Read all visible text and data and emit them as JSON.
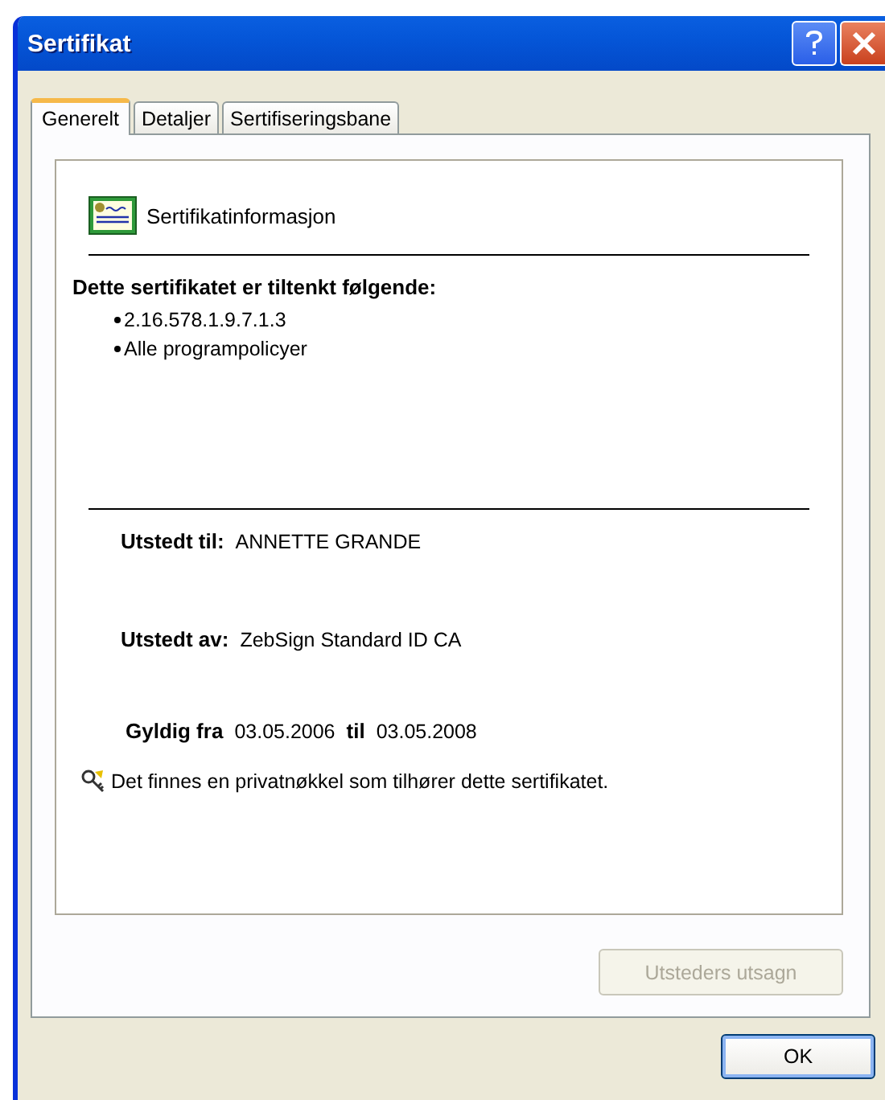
{
  "window": {
    "title": "Sertifikat"
  },
  "tabs": [
    {
      "label": "Generelt",
      "selected": true
    },
    {
      "label": "Detaljer",
      "selected": false
    },
    {
      "label": "Sertifiseringsbane",
      "selected": false
    }
  ],
  "certificate_info": {
    "title": "Sertifikatinformasjon",
    "purpose_heading": "Dette sertifikatet er tiltenkt følgende:",
    "purposes": [
      "2.16.578.1.9.7.1.3",
      "Alle programpolicyer"
    ],
    "issued_to": {
      "label": "Utstedt til:",
      "value": "ANNETTE GRANDE"
    },
    "issued_by": {
      "label": "Utstedt av:",
      "value": "ZebSign Standard ID CA"
    },
    "validity": {
      "from_label": "Gyldig fra",
      "from": "03.05.2006",
      "to_label": "til",
      "to": "03.05.2008"
    },
    "private_key_note": "Det finnes en privatnøkkel som tilhører dette sertifikatet."
  },
  "issuer_statement_button": {
    "label": "Utsteders utsagn",
    "disabled": true
  },
  "ok_button": {
    "label": "OK"
  }
}
